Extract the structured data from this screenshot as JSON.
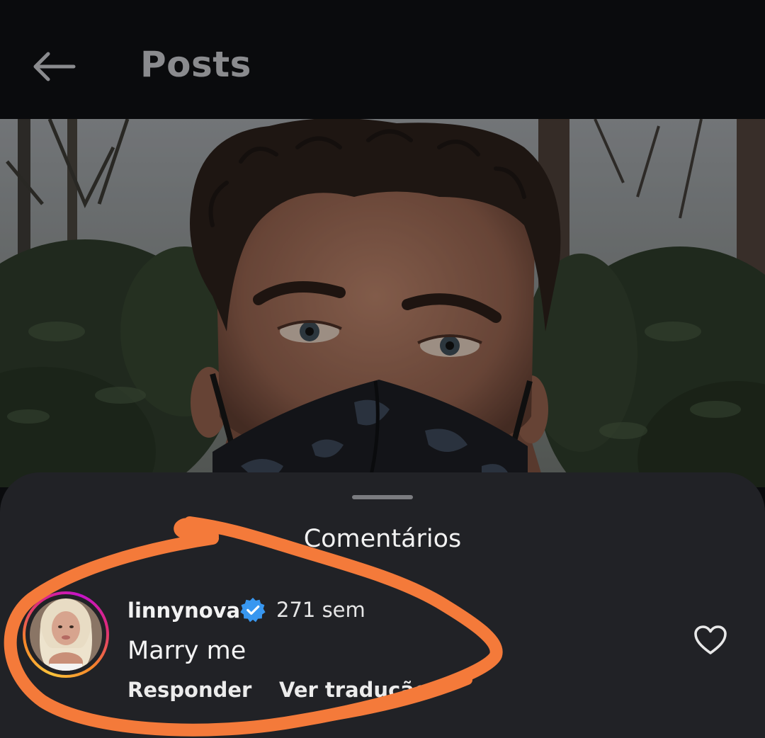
{
  "header": {
    "title": "Posts",
    "back_icon": "arrow-left-icon"
  },
  "comments_sheet": {
    "title": "Comentários",
    "comments": [
      {
        "username": "linnynova",
        "verified": true,
        "time": "271 sem",
        "text": "Marry me",
        "reply_label": "Responder",
        "translate_label": "Ver tradução"
      }
    ]
  },
  "colors": {
    "background": "#0a0b0d",
    "sheet": "#212226",
    "verified_badge": "#3897f0",
    "highlight_stroke": "#f47a3a"
  }
}
